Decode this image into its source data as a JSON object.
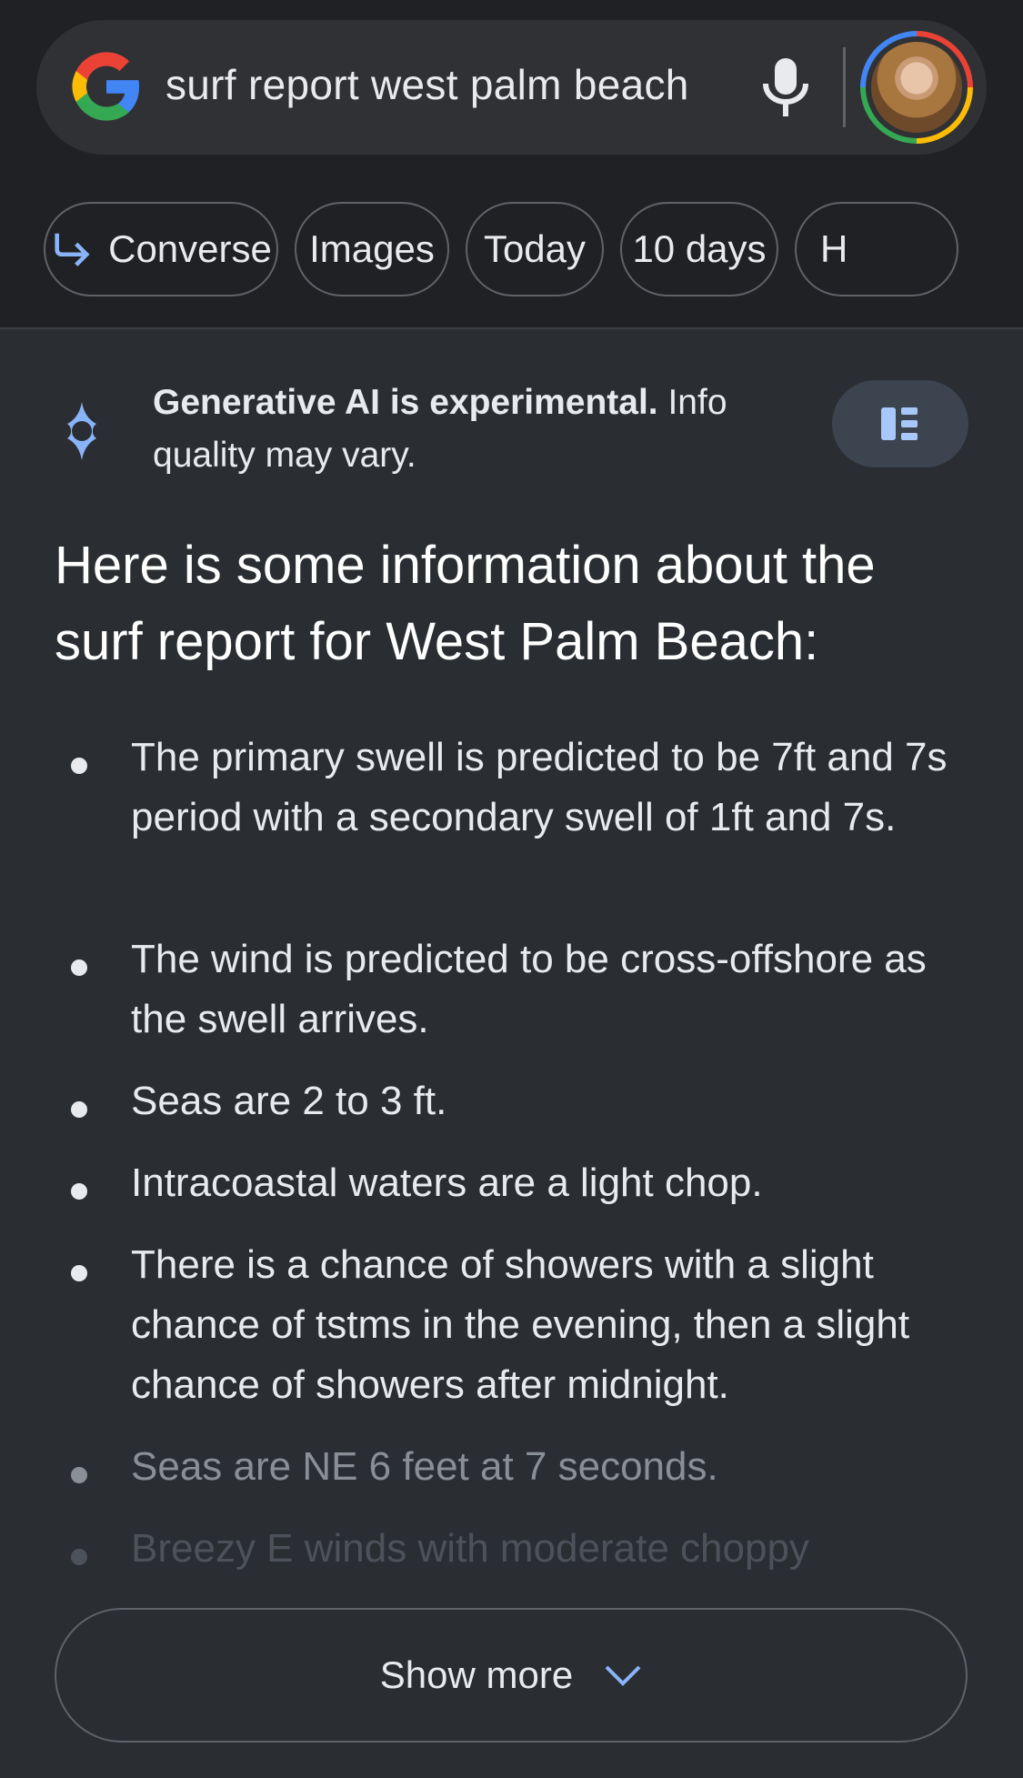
{
  "search": {
    "query": "surf report west palm beach"
  },
  "chips": [
    {
      "label": "Converse",
      "icon": "reply-arrow-icon"
    },
    {
      "label": "Images"
    },
    {
      "label": "Today"
    },
    {
      "label": "10 days"
    },
    {
      "label": "H"
    }
  ],
  "ai_notice": {
    "bold": "Generative AI is experimental.",
    "rest": " Info quality may vary."
  },
  "summary": "Here is some information about the surf report for West Palm Beach:",
  "bullets": [
    "The primary swell is predicted to be 7ft and 7s period with a secondary swell of 1ft and 7s.",
    "The wind is predicted to be cross-offshore as the swell arrives.",
    "Seas are 2 to 3 ft.",
    "Intracoastal waters are a light chop.",
    "There is a chance of showers with a slight chance of tstms in the evening, then a slight chance of showers after midnight.",
    "Seas are NE 6 feet at 7 seconds.",
    "Breezy E winds with moderate choppy"
  ],
  "show_more": "Show more",
  "colors": {
    "background": "#2a2e33",
    "header": "#202124",
    "accent_blue": "#8ab4f8",
    "text": "#e8eaed"
  }
}
